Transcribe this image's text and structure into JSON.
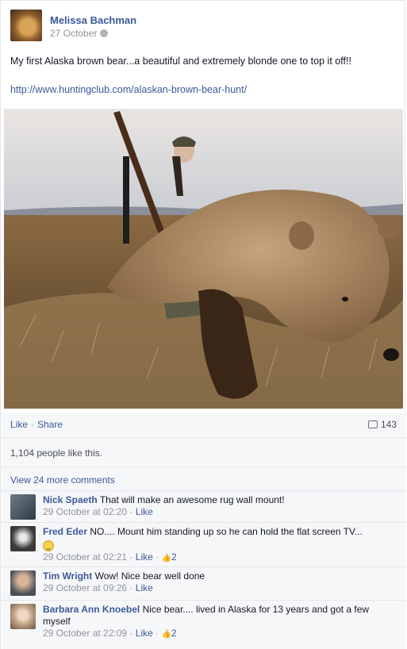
{
  "post": {
    "author": "Melissa Bachman",
    "date": "27 October",
    "text": "My first Alaska brown bear...a beautiful and extremely blonde one to top it off!!",
    "link": "http://www.huntingclub.com/alaskan-brown-bear-hunt/"
  },
  "actions": {
    "like": "Like",
    "separator": "·",
    "share": "Share",
    "comment_count": "143"
  },
  "likes_text": "1,104 people like this.",
  "view_more": "View 24 more comments",
  "comments": [
    {
      "name": "Nick Spaeth",
      "text": "That will make an awesome rug wall mount!",
      "time": "29 October at 02:20",
      "like": "Like",
      "likes": ""
    },
    {
      "name": "Fred Eder",
      "text": "NO.... Mount him standing up so he can hold the flat screen TV...",
      "time": "29 October at 02:21",
      "like": "Like",
      "likes": "2"
    },
    {
      "name": "Tim Wright",
      "text": "Wow! Nice bear well done",
      "time": "29 October at 09:26",
      "like": "Like",
      "likes": ""
    },
    {
      "name": "Barbara Ann Knoebel",
      "text": "Nice bear.... lived in Alaska for 13 years and got a few myself",
      "time": "29 October at 22:09",
      "like": "Like",
      "likes": "2"
    }
  ],
  "colors": {
    "link": "#3b5998",
    "muted": "#90949c",
    "panel": "#f6f7f9"
  }
}
